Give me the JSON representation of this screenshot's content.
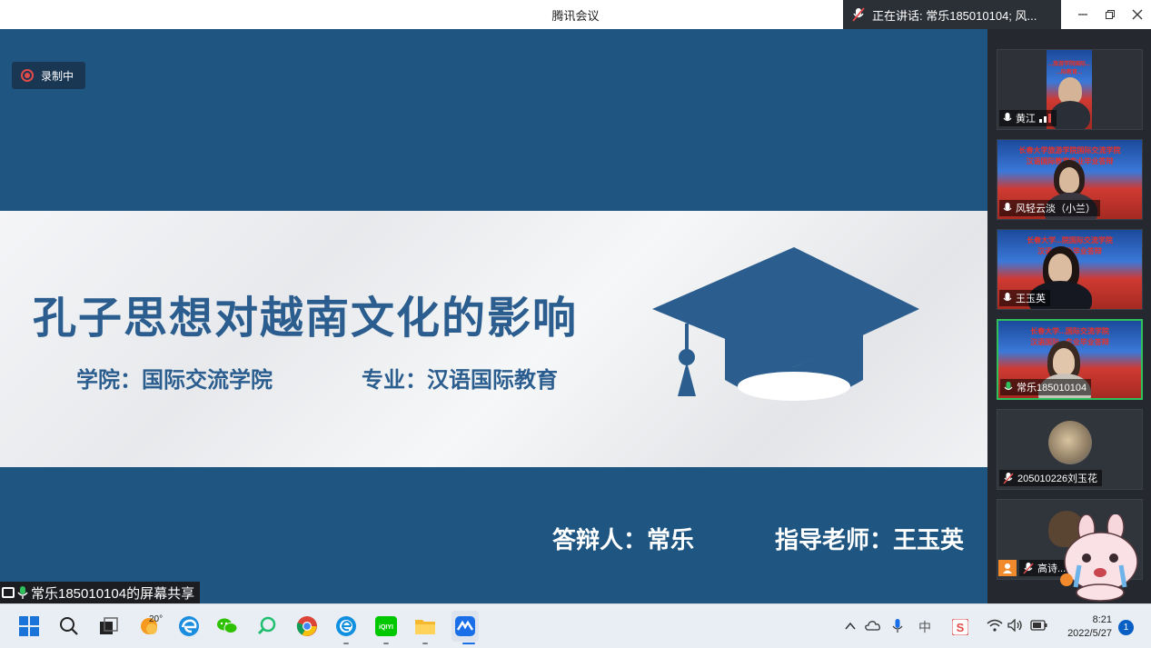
{
  "titlebar": {
    "title": "腾讯会议",
    "speaking": "正在讲话: 常乐185010104; 风..."
  },
  "main": {
    "recording_label": "录制中",
    "share_label": "常乐185010104的屏幕共享"
  },
  "slide": {
    "title": "孔子思想对越南文化的影响",
    "college": "学院：国际交流学院",
    "major": "专业：汉语国际教育",
    "defender": "答辩人：常乐",
    "advisor": "指导老师：王玉英",
    "colors": {
      "blue": "#1f5681",
      "title_blue": "#2b5e8f"
    }
  },
  "participants": [
    {
      "name": "黄江",
      "banner": [
        "...旅游学院国际...",
        "...际教育..."
      ],
      "mic": "on"
    },
    {
      "name": "风轻云淡（小兰）",
      "banner": [
        "长春大学旅游学院国际交流学院",
        "汉语国际教育专业毕业答辩"
      ],
      "mic": "on"
    },
    {
      "name": "王玉英",
      "banner": [
        "长春大学...院国际交流学院",
        "汉语...专业毕业答辩"
      ],
      "mic": "on"
    },
    {
      "name": "常乐185010104",
      "banner": [
        "长春大学...国际交流学院",
        "汉语国际...专业毕业答辩"
      ],
      "mic": "on",
      "active": true
    },
    {
      "name": "205010226刘玉花",
      "mic": "off"
    },
    {
      "name": "高诗...",
      "mic": "off"
    }
  ],
  "taskbar": {
    "weather_temp": "20°",
    "ime": "中",
    "time": "8:21",
    "date": "2022/5/27",
    "notifications": "1"
  }
}
